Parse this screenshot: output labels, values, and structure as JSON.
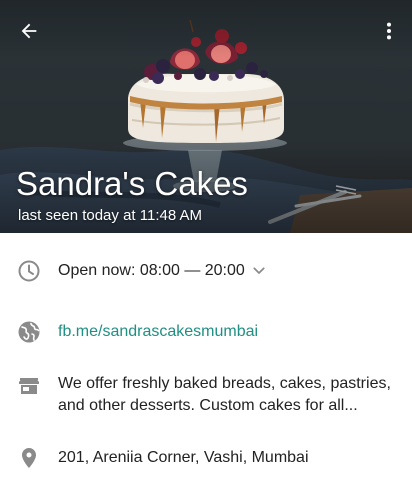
{
  "header": {
    "name": "Sandra's Cakes",
    "status": "last seen today at 11:48 AM",
    "back_icon": "arrow-left-icon",
    "menu_icon": "more-vert-icon"
  },
  "info": {
    "hours": {
      "icon": "clock-icon",
      "text": "Open now: 08:00 — 20:00",
      "expand_icon": "chevron-down-icon"
    },
    "website": {
      "icon": "globe-icon",
      "text": "fb.me/sandrascakesmumbai"
    },
    "description": {
      "icon": "store-icon",
      "text": "We offer freshly baked breads, cakes, pastries, and other desserts. Custom cakes for all..."
    },
    "address": {
      "icon": "location-pin-icon",
      "text": "201, Areniia Corner, Vashi, Mumbai"
    }
  },
  "colors": {
    "link": "#1f8f83",
    "icon_gray": "#8a8a8a",
    "text": "#222222"
  }
}
